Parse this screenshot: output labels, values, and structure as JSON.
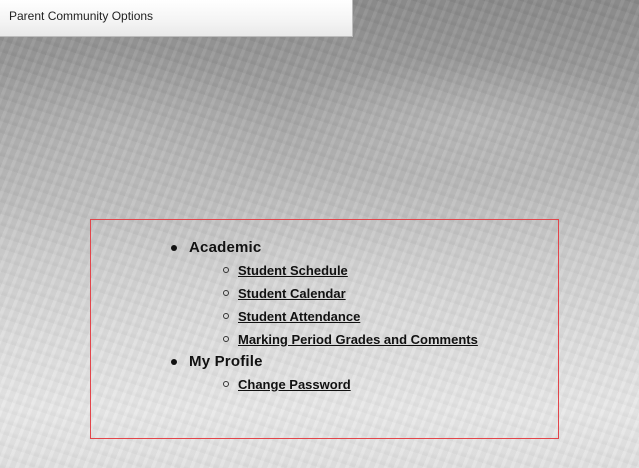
{
  "header": {
    "title": "Parent Community Options"
  },
  "menu": {
    "sections": [
      {
        "label": "Academic",
        "links": [
          "Student Schedule",
          "Student Calendar",
          "Student Attendance",
          "Marking Period Grades and Comments"
        ]
      },
      {
        "label": "My Profile",
        "links": [
          "Change Password"
        ]
      }
    ]
  },
  "colors": {
    "frame_border": "#e2454a",
    "header_background": "#f4f4f4",
    "page_background": "#c9c9c9"
  }
}
